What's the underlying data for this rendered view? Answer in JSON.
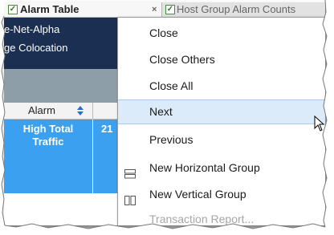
{
  "tabs": {
    "active_label": "Alarm Table",
    "inactive_label": "Host Group Alarm Counts",
    "close_glyph": "×"
  },
  "nav": {
    "item1": "e-Net-Alpha",
    "item2": "ge Colocation"
  },
  "table": {
    "alarm_header": "Alarm",
    "alarm_cell_line1": "High Total",
    "alarm_cell_line2": "Traffic",
    "value_cell": "21"
  },
  "menu": {
    "items": [
      {
        "label": "Close"
      },
      {
        "label": "Close Others"
      },
      {
        "label": "Close All"
      },
      {
        "label": "Next"
      },
      {
        "label": "Previous"
      },
      {
        "label": "New Horizontal Group"
      },
      {
        "label": "New Vertical Group"
      },
      {
        "label": "Transaction Report..."
      }
    ]
  },
  "colors": {
    "nav_bg": "#1b2f52",
    "highlight_cell": "#3ba0f0",
    "menu_hover": "#dcebf9"
  },
  "icons": [
    "check-icon",
    "close-icon",
    "sort-icon",
    "horizontal-group-icon",
    "vertical-group-icon",
    "mouse-cursor-icon"
  ]
}
